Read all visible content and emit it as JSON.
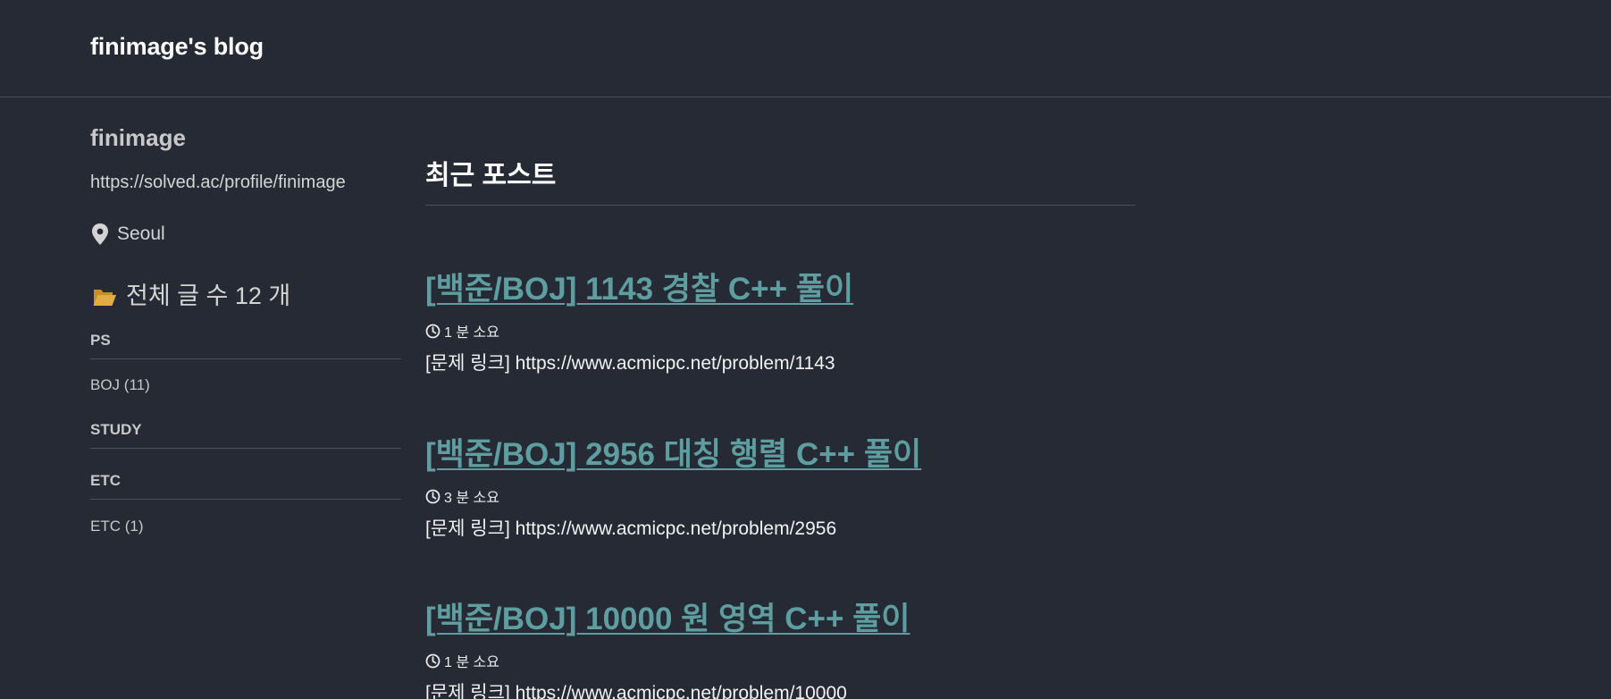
{
  "site": {
    "title": "finimage's blog"
  },
  "author": {
    "name": "finimage",
    "link": "https://solved.ac/profile/finimage",
    "location": "Seoul"
  },
  "nav": {
    "total_posts": "전체 글 수 12 개",
    "categories": [
      {
        "heading": "PS",
        "items": [
          "BOJ (11)"
        ]
      },
      {
        "heading": "STUDY",
        "items": []
      },
      {
        "heading": "ETC",
        "items": [
          "ETC (1)"
        ]
      }
    ]
  },
  "main": {
    "section_title": "최근 포스트",
    "posts": [
      {
        "title": "[백준/BOJ] 1143 경찰 C++ 풀이",
        "read_time": "1 분 소요",
        "excerpt": "[문제 링크] https://www.acmicpc.net/problem/1143"
      },
      {
        "title": "[백준/BOJ] 2956 대칭 행렬 C++ 풀이",
        "read_time": "3 분 소요",
        "excerpt": "[문제 링크] https://www.acmicpc.net/problem/2956"
      },
      {
        "title": "[백준/BOJ] 10000 원 영역 C++ 풀이",
        "read_time": "1 분 소요",
        "excerpt": "[문제 링크] https://www.acmicpc.net/problem/10000"
      }
    ]
  },
  "icons": {
    "location": "map-marker-icon",
    "folder": "folder-open-icon",
    "clock": "clock-icon"
  },
  "colors": {
    "background": "#252a34",
    "link_accent": "#5f9ea0",
    "folder": "#d9a53f",
    "divider": "#4a4f59"
  }
}
